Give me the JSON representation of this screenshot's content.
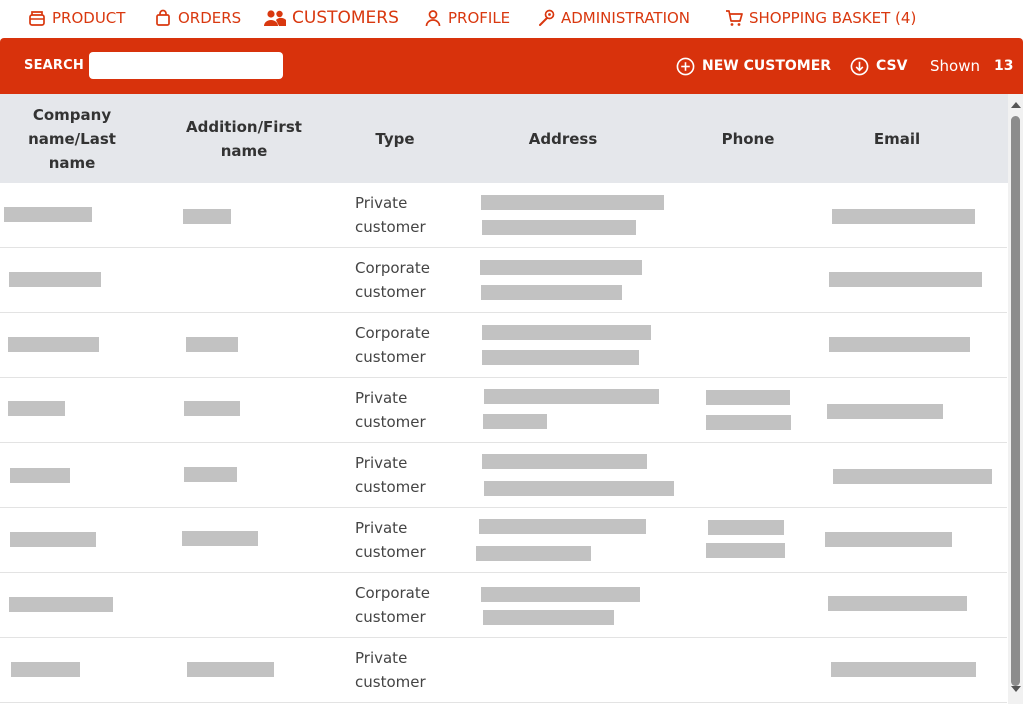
{
  "nav": {
    "items": [
      {
        "label": "PRODUCT",
        "icon": "box-icon"
      },
      {
        "label": "ORDERS",
        "icon": "bag-icon"
      },
      {
        "label": "CUSTOMERS",
        "icon": "users-icon"
      },
      {
        "label": "PROFILE",
        "icon": "user-icon"
      },
      {
        "label": "ADMINISTRATION",
        "icon": "wrench-icon"
      },
      {
        "label": "SHOPPING BASKET (4)",
        "icon": "cart-icon"
      }
    ],
    "active": "CUSTOMERS"
  },
  "toolbar": {
    "search_label": "SEARCH",
    "search_value": "",
    "new_customer_label": "NEW CUSTOMER",
    "csv_label": "CSV",
    "shown_label": "Shown",
    "shown_count": "13"
  },
  "table": {
    "headers": [
      "Company name/Last name",
      "Addition/First name",
      "Type",
      "Address",
      "Phone",
      "Email"
    ],
    "rows": [
      {
        "type_line1": "Private",
        "type_line2": "customer"
      },
      {
        "type_line1": "Corporate",
        "type_line2": "customer"
      },
      {
        "type_line1": "Corporate",
        "type_line2": "customer"
      },
      {
        "type_line1": "Private",
        "type_line2": "customer"
      },
      {
        "type_line1": "Private",
        "type_line2": "customer"
      },
      {
        "type_line1": "Private",
        "type_line2": "customer"
      },
      {
        "type_line1": "Corporate",
        "type_line2": "customer"
      },
      {
        "type_line1": "Private",
        "type_line2": "customer"
      }
    ]
  },
  "colors": {
    "accent": "#d8320c",
    "nav_text": "#d9380f",
    "header_bg": "#e5e7eb",
    "redaction": "#c2c2c2"
  }
}
